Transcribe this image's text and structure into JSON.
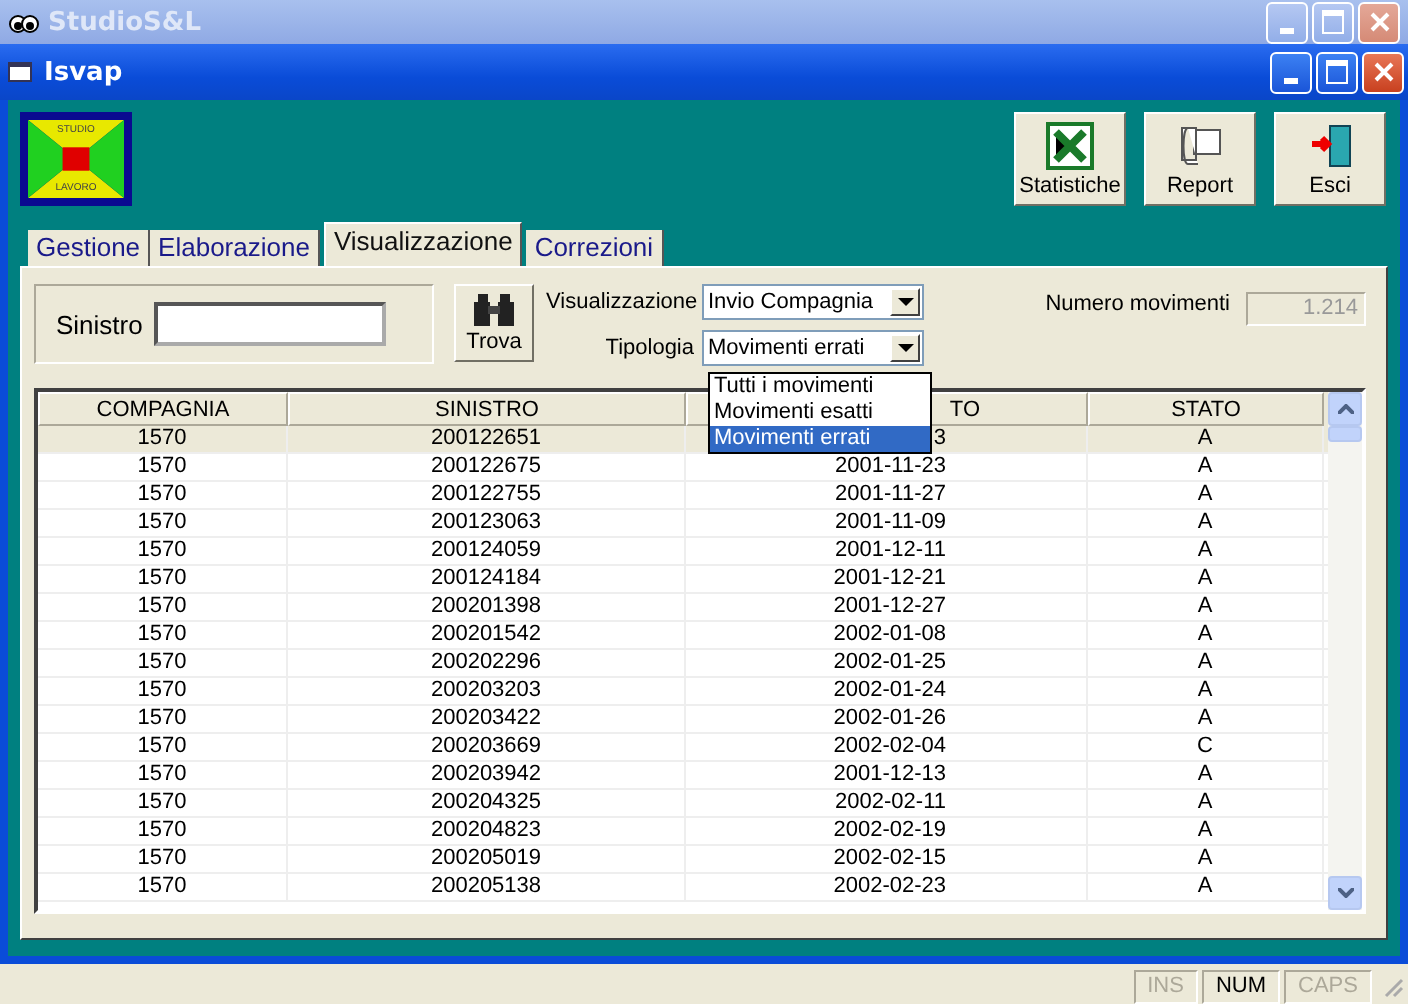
{
  "window": {
    "title": "StudioS&L"
  },
  "child_window": {
    "title": "Isvap"
  },
  "logo": {
    "top_text": "STUDIO",
    "bottom_text": "LAVORO"
  },
  "toolbar": [
    {
      "kind": "excel",
      "label": "Statistiche"
    },
    {
      "kind": "report",
      "label": "Report"
    },
    {
      "kind": "exit",
      "label": "Esci"
    }
  ],
  "tabs": [
    {
      "label": "Gestione",
      "selected": false
    },
    {
      "label": "Elaborazione",
      "selected": false
    },
    {
      "label": "Visualizzazione",
      "selected": true
    },
    {
      "label": "Correzioni",
      "selected": false
    }
  ],
  "search": {
    "label": "Sinistro",
    "button": "Trova"
  },
  "filters": [
    {
      "label": "Visualizzazione",
      "value": "Invio Compagnia"
    },
    {
      "label": "Tipologia",
      "value": "Movimenti errati"
    }
  ],
  "dropdown_options": [
    {
      "label": "Tutti i movimenti",
      "selected": false
    },
    {
      "label": "Movimenti esatti",
      "selected": false
    },
    {
      "label": "Movimenti errati",
      "selected": true
    }
  ],
  "count": {
    "label": "Numero movimenti",
    "value": "1.214",
    "disabled": true
  },
  "table": {
    "columns": [
      "COMPAGNIA",
      "SINISTRO",
      "TO",
      "STATO"
    ],
    "rows": [
      {
        "selected": true,
        "cells": [
          "1570",
          "200122651",
          "3",
          "A"
        ]
      },
      {
        "selected": false,
        "cells": [
          "1570",
          "200122675",
          "2001-11-23",
          "A"
        ]
      },
      {
        "selected": false,
        "cells": [
          "1570",
          "200122755",
          "2001-11-27",
          "A"
        ]
      },
      {
        "selected": false,
        "cells": [
          "1570",
          "200123063",
          "2001-11-09",
          "A"
        ]
      },
      {
        "selected": false,
        "cells": [
          "1570",
          "200124059",
          "2001-12-11",
          "A"
        ]
      },
      {
        "selected": false,
        "cells": [
          "1570",
          "200124184",
          "2001-12-21",
          "A"
        ]
      },
      {
        "selected": false,
        "cells": [
          "1570",
          "200201398",
          "2001-12-27",
          "A"
        ]
      },
      {
        "selected": false,
        "cells": [
          "1570",
          "200201542",
          "2002-01-08",
          "A"
        ]
      },
      {
        "selected": false,
        "cells": [
          "1570",
          "200202296",
          "2002-01-25",
          "A"
        ]
      },
      {
        "selected": false,
        "cells": [
          "1570",
          "200203203",
          "2002-01-24",
          "A"
        ]
      },
      {
        "selected": false,
        "cells": [
          "1570",
          "200203422",
          "2002-01-26",
          "A"
        ]
      },
      {
        "selected": false,
        "cells": [
          "1570",
          "200203669",
          "2002-02-04",
          "C"
        ]
      },
      {
        "selected": false,
        "cells": [
          "1570",
          "200203942",
          "2001-12-13",
          "A"
        ]
      },
      {
        "selected": false,
        "cells": [
          "1570",
          "200204325",
          "2002-02-11",
          "A"
        ]
      },
      {
        "selected": false,
        "cells": [
          "1570",
          "200204823",
          "2002-02-19",
          "A"
        ]
      },
      {
        "selected": false,
        "cells": [
          "1570",
          "200205019",
          "2002-02-15",
          "A"
        ]
      },
      {
        "selected": false,
        "cells": [
          "1570",
          "200205138",
          "2002-02-23",
          "A"
        ]
      }
    ]
  },
  "status_bar": [
    {
      "label": "INS",
      "disabled": true
    },
    {
      "label": "NUM",
      "disabled": false
    },
    {
      "label": "CAPS",
      "disabled": true
    }
  ]
}
